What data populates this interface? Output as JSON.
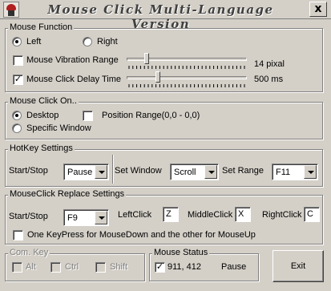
{
  "window": {
    "title": "Mouse Click Multi-Language Version",
    "close_label": "x"
  },
  "mouse_function": {
    "legend": "Mouse Function",
    "left_label": "Left",
    "left_selected": true,
    "right_label": "Right",
    "right_selected": false,
    "vibration": {
      "label": "Mouse Vibration Range",
      "checked": false,
      "value": "14 pixal",
      "slider_fraction": 0.15
    },
    "delay": {
      "label": "Mouse Click Delay Time",
      "checked": true,
      "value": "500 ms",
      "slider_fraction": 0.25
    }
  },
  "mouse_click_on": {
    "legend": "Mouse Click On..",
    "desktop_label": "Desktop",
    "desktop_selected": true,
    "specific_window_label": "Specific Window",
    "specific_window_selected": false,
    "position_range_label": "Position Range(0,0 - 0,0)",
    "position_range_checked": false
  },
  "hotkey": {
    "legend": "HotKey Settings",
    "start_stop_label": "Start/Stop",
    "start_stop_value": "Pause",
    "set_window_label": "Set Window",
    "set_window_value": "Scroll",
    "set_range_label": "Set Range",
    "set_range_value": "F11"
  },
  "replace": {
    "legend": "MouseClick Replace Settings",
    "start_stop_label": "Start/Stop",
    "start_stop_value": "F9",
    "leftclick_label": "LeftClick",
    "leftclick_value": "Z",
    "middleclick_label": "MiddleClick",
    "middleclick_value": "X",
    "rightclick_label": "RightClick",
    "rightclick_value": "C",
    "one_keypress_label": "One KeyPress for MouseDown and the other for MouseUp",
    "one_keypress_checked": false
  },
  "com_key": {
    "legend": "Com. Key",
    "alt": "Alt",
    "ctrl": "Ctrl",
    "shift": "Shift"
  },
  "mouse_status": {
    "legend": "Mouse Status",
    "coords": "911, 412",
    "coords_checked": true,
    "state": "Pause"
  },
  "exit_label": "Exit",
  "colors": {
    "face": "#d4d0c8",
    "shadow": "#808080",
    "highlight": "#ffffff",
    "dark": "#404040"
  }
}
